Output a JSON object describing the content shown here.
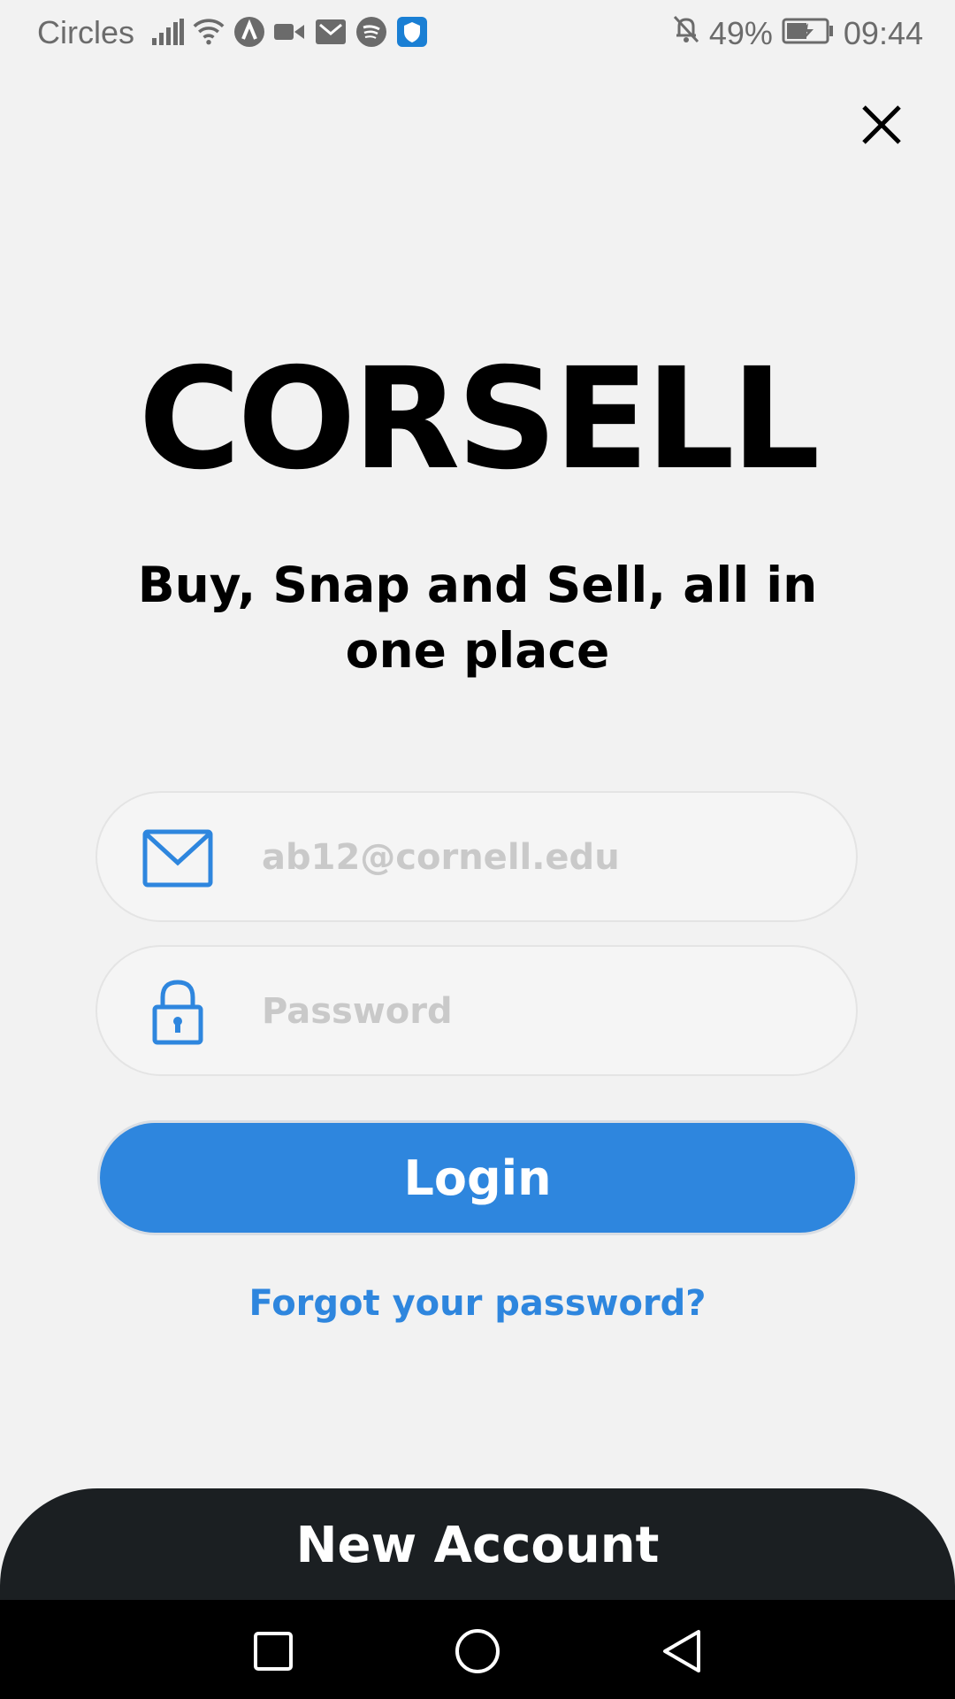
{
  "status_bar": {
    "carrier": "Circles",
    "battery_percent": "49%",
    "time": "09:44",
    "icons": [
      "signal-icon",
      "wifi-icon",
      "app-a-icon",
      "video-icon",
      "gmail-icon",
      "spotify-icon",
      "shield-icon",
      "bell-off-icon",
      "battery-charging-icon"
    ]
  },
  "close_icon": "close-icon",
  "logo": "CORSELL",
  "tagline": "Buy, Snap and Sell, all in one place",
  "email": {
    "placeholder": "ab12@cornell.edu",
    "value": "",
    "icon": "mail-icon"
  },
  "password": {
    "placeholder": "Password",
    "value": "",
    "icon": "lock-icon"
  },
  "login_label": "Login",
  "forgot_label": "Forgot your password?",
  "new_account_label": "New Account",
  "colors": {
    "accent": "#2e86de",
    "background": "#f2f2f2",
    "dark": "#1b1f22"
  },
  "nav": [
    "recents-icon",
    "home-icon",
    "back-icon"
  ]
}
